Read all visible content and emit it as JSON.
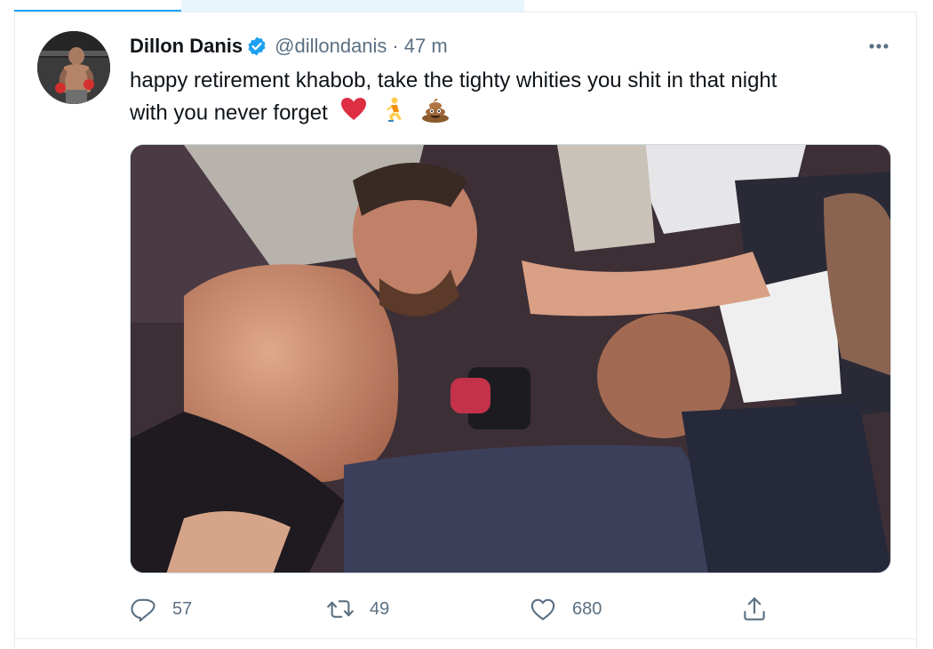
{
  "tweet": {
    "author": {
      "name": "Dillon Danis",
      "handle": "@dillondanis",
      "separator": "·",
      "time": "47 m"
    },
    "text_line1": "happy retirement khabob, take the tighty whities you shit in that night",
    "text_line2": "with you never forget",
    "emojis": [
      "red-heart",
      "person-kneeling",
      "pile-of-poo"
    ],
    "stats": {
      "replies": "57",
      "retweets": "49",
      "likes": "680"
    }
  },
  "colors": {
    "accent": "#1da1f2",
    "muted": "#5b7083",
    "text": "#0f1419",
    "border": "#e6ecf0"
  },
  "icons": [
    "verified-badge-icon",
    "more-icon",
    "reply-icon",
    "retweet-icon",
    "like-icon",
    "share-icon"
  ]
}
